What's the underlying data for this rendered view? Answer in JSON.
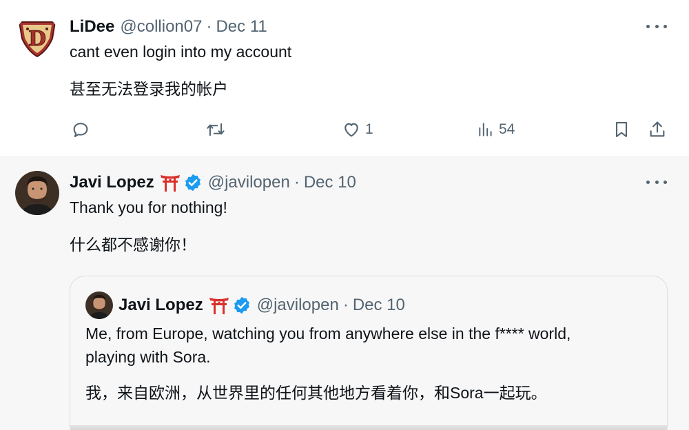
{
  "tweets": [
    {
      "author": {
        "name": "LiDee",
        "handle": "@collion07",
        "date": "Dec 11"
      },
      "text_en": "cant even login into my account",
      "text_zh": "甚至无法登录我的帐户",
      "actions": {
        "reply_count": "",
        "retweet_count": "",
        "like_count": "1",
        "view_count": "54"
      }
    },
    {
      "author": {
        "name": "Javi Lopez",
        "emoji": "⛩",
        "verified": true,
        "handle": "@javilopen",
        "date": "Dec 10"
      },
      "text_en": "Thank you for nothing!",
      "text_zh": "什么都不感谢你！",
      "quote": {
        "author": {
          "name": "Javi Lopez",
          "emoji": "⛩",
          "verified": true,
          "handle": "@javilopen",
          "date": "Dec 10"
        },
        "text_en_line1": "Me, from Europe, watching you from anywhere else in the f**** world,",
        "text_en_line2": "playing with Sora.",
        "text_zh": "我，来自欧洲，从世界里的任何其他地方看着你，和Sora一起玩。"
      }
    }
  ],
  "colors": {
    "name": "#0f1419",
    "meta": "#536471",
    "verified": "#1d9bf0",
    "torii": "#d9302c",
    "shield": "#a8322e"
  },
  "icons": [
    "reply-icon",
    "retweet-icon",
    "like-icon",
    "views-icon",
    "bookmark-icon",
    "share-icon",
    "more-icon",
    "verified-icon",
    "torii-gate-icon"
  ]
}
